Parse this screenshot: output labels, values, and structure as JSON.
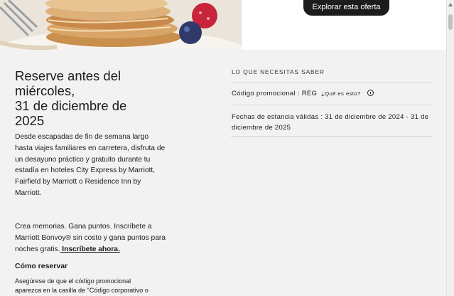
{
  "hero": {
    "explore_label": "Explorar esta oferta"
  },
  "offer": {
    "headline_line1": "Reserve antes del",
    "headline_line2": "miércoles,",
    "headline_line3": "31 de diciembre de",
    "headline_line4": "2025",
    "description": "Desde escapadas de fin de semana largo hasta viajes familiares en carretera, disfruta de un desayuno práctico y gratuito durante tu estadía en hoteles City Express by Marriott, Fairfield by Marriott o Residence Inn by Marriott.",
    "bonvoy_text": "Crea memorias. Gana puntos. Inscríbete a Marriott Bonvoy® sin costo y gana puntos para noches gratis.",
    "bonvoy_link": " Inscríbete ahora.",
    "how_title": "Cómo reservar",
    "how_desc": "Asegúrese de que el código promocional aparezca en la casilla de \"Código corporativo o"
  },
  "details": {
    "section_title": "LO QUE NECESITAS SABER",
    "promo_label": "Código promocional : REG",
    "promo_what": "¿Qué es esto?",
    "dates_label": "Fechas de estancia válidas : 31 de diciembre de 2024 - 31 de diciembre de 2025"
  }
}
